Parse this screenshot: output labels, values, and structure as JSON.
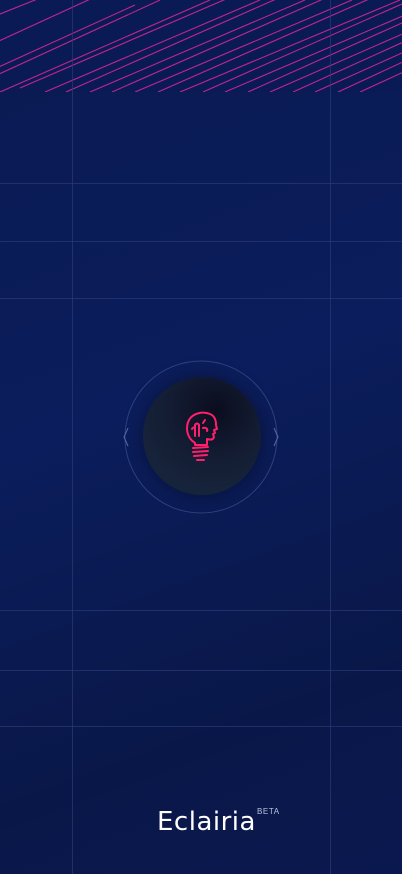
{
  "app": {
    "name": "Eclairia",
    "badge": "BETA"
  },
  "splash": {
    "logo_icon": "lightbulb-head-icon",
    "colors": {
      "background": "#0b1d5c",
      "accent": "#ff1f6b",
      "stripes": "#e0289a",
      "grid_lines": "#2a3b78",
      "logo_disc": "#16233a",
      "text": "#ffffff"
    }
  }
}
